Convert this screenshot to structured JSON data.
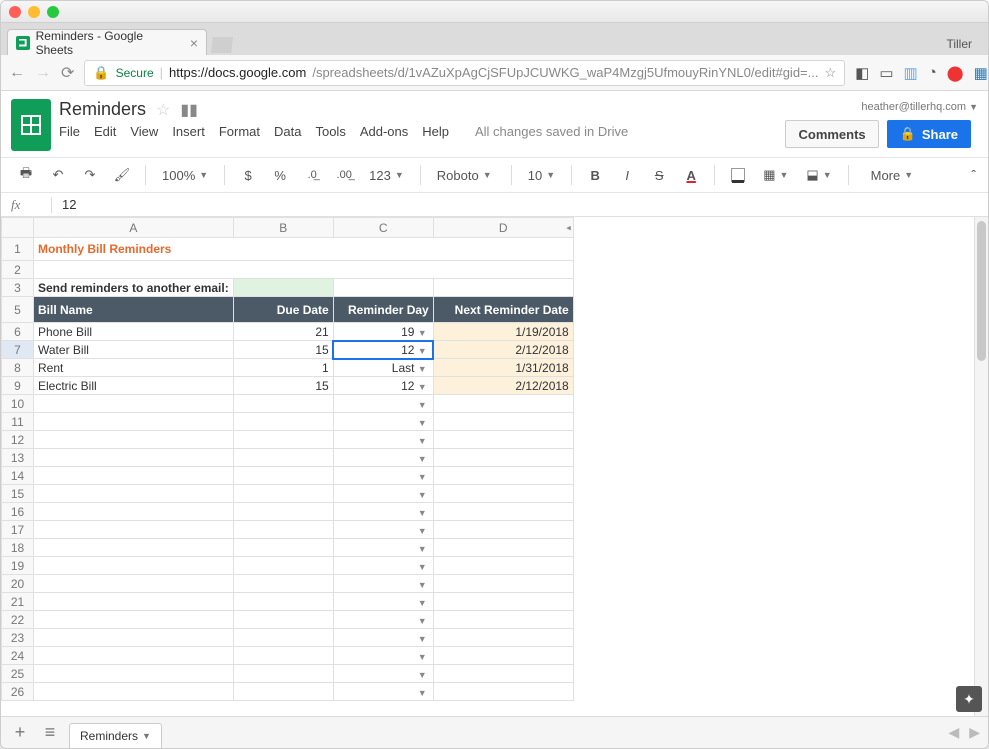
{
  "browser": {
    "tab_title": "Reminders - Google Sheets",
    "profile": "Tiller",
    "secure_label": "Secure",
    "url_host": "https://docs.google.com",
    "url_rest": "/spreadsheets/d/1vAZuXpAgCjSFUpJCUWKG_waP4Mzgj5UfmouyRinYNL0/edit#gid=..."
  },
  "doc": {
    "title": "Reminders",
    "account": "heather@tillerhq.com",
    "comments_btn": "Comments",
    "share_btn": "Share",
    "saved_msg": "All changes saved in Drive"
  },
  "menus": {
    "file": "File",
    "edit": "Edit",
    "view": "View",
    "insert": "Insert",
    "format": "Format",
    "data": "Data",
    "tools": "Tools",
    "addons": "Add-ons",
    "help": "Help"
  },
  "toolbar": {
    "zoom": "100%",
    "currency": "$",
    "percent": "%",
    "dec_dec": ".0",
    "inc_dec": ".00",
    "num_format": "123",
    "font": "Roboto",
    "font_size": "10",
    "more": "More"
  },
  "formula_bar": {
    "value": "12"
  },
  "columns": {
    "A": "A",
    "B": "B",
    "C": "C",
    "D": "D"
  },
  "content": {
    "title": "Monthly Bill Reminders",
    "subtitle": "Send reminders to another email:",
    "headers": {
      "name": "Bill Name",
      "due": "Due Date",
      "reminder": "Reminder Day",
      "next": "Next Reminder Date"
    },
    "rows": [
      {
        "name": "Phone Bill",
        "due": "21",
        "reminder": "19",
        "next": "1/19/2018"
      },
      {
        "name": "Water Bill",
        "due": "15",
        "reminder": "12",
        "next": "2/12/2018"
      },
      {
        "name": "Rent",
        "due": "1",
        "reminder": "Last",
        "next": "1/31/2018"
      },
      {
        "name": "Electric Bill",
        "due": "15",
        "reminder": "12",
        "next": "2/12/2018"
      }
    ]
  },
  "sheet_tab": "Reminders"
}
